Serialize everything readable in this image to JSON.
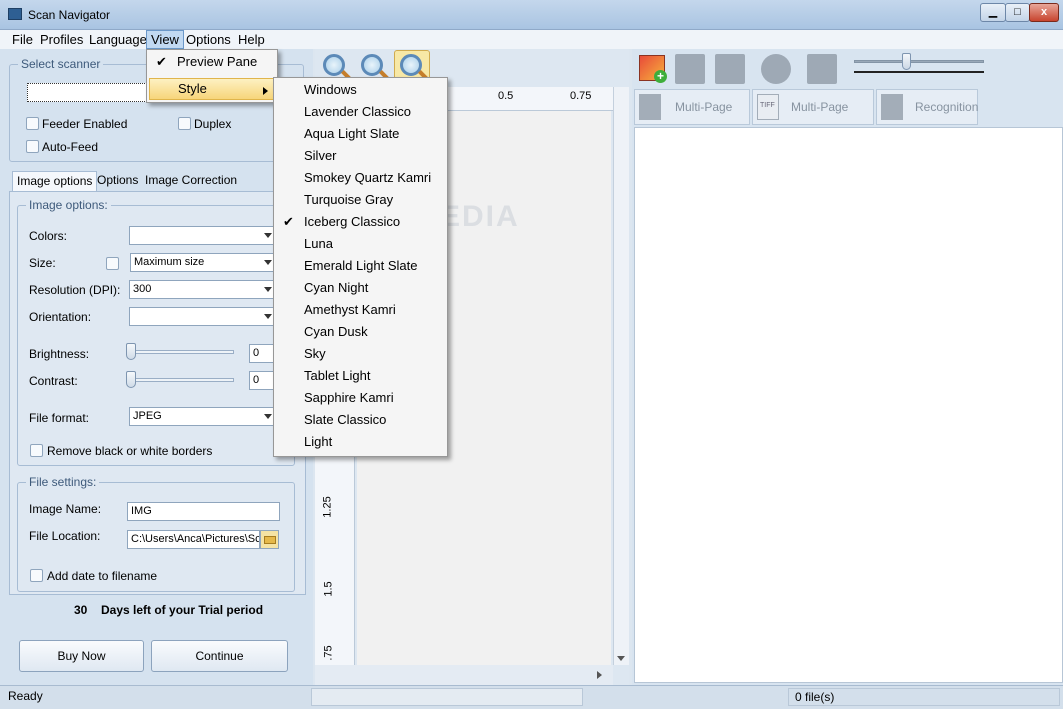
{
  "window": {
    "title": "Scan Navigator",
    "close_glyph": "x"
  },
  "menubar": {
    "items": [
      "File",
      "Profiles",
      "Language",
      "View",
      "Options",
      "Help"
    ]
  },
  "view_menu": {
    "preview_pane": "Preview Pane",
    "style": "Style",
    "check": "✔"
  },
  "style_menu": {
    "items": [
      "Windows",
      "Lavender Classico",
      "Aqua Light Slate",
      "Silver",
      "Smokey Quartz Kamri",
      "Turquoise Gray",
      "Iceberg Classico",
      "Luna",
      "Emerald Light Slate",
      "Cyan Night",
      "Amethyst Kamri",
      "Cyan Dusk",
      "Sky",
      "Tablet Light",
      "Sapphire Kamri",
      "Slate Classico",
      "Light"
    ],
    "checked_item": "Iceberg Classico",
    "check": "✔"
  },
  "scanner": {
    "legend": "Select scanner",
    "feeder_enabled": "Feeder Enabled",
    "duplex": "Duplex",
    "auto_feed": "Auto-Feed"
  },
  "tabs": [
    "Image options",
    "Options",
    "Image Correction"
  ],
  "image_options": {
    "legend": "Image options:",
    "colors_label": "Colors:",
    "size_label": "Size:",
    "size_value": "Maximum size",
    "resolution_label": "Resolution (DPI):",
    "resolution_value": "300",
    "orientation_label": "Orientation:",
    "brightness_label": "Brightness:",
    "brightness_value": "0",
    "contrast_label": "Contrast:",
    "contrast_value": "0",
    "file_format_label": "File format:",
    "file_format_value": "JPEG",
    "remove_borders": "Remove black or white borders"
  },
  "file_settings": {
    "legend": "File settings:",
    "image_name_label": "Image Name:",
    "image_name_value": "IMG",
    "file_location_label": "File Location:",
    "file_location_value": "C:\\Users\\Anca\\Pictures\\Sc",
    "add_date": "Add date to filename"
  },
  "trial": {
    "days": "30",
    "text": "Days left of your Trial period"
  },
  "buttons": {
    "buy_now": "Buy Now",
    "continue": "Continue"
  },
  "ruler": {
    "h_labels": [
      "0.5",
      "0.75"
    ],
    "v_labels": [
      "1.25",
      "1.5",
      ".75"
    ]
  },
  "right_toolbar": {
    "multi_pdf": "Multi-Page PDF",
    "multi_tiff": "Multi-Page TIFF",
    "recognition": "Recognition",
    "tiff_badge": "TIFF"
  },
  "status": {
    "ready": "Ready",
    "files": "0 file(s)"
  },
  "watermark": "SOFTPEDIA",
  "colors": {
    "menu_hover": "#f7d57a",
    "window_bg": "#d5e2ef"
  }
}
